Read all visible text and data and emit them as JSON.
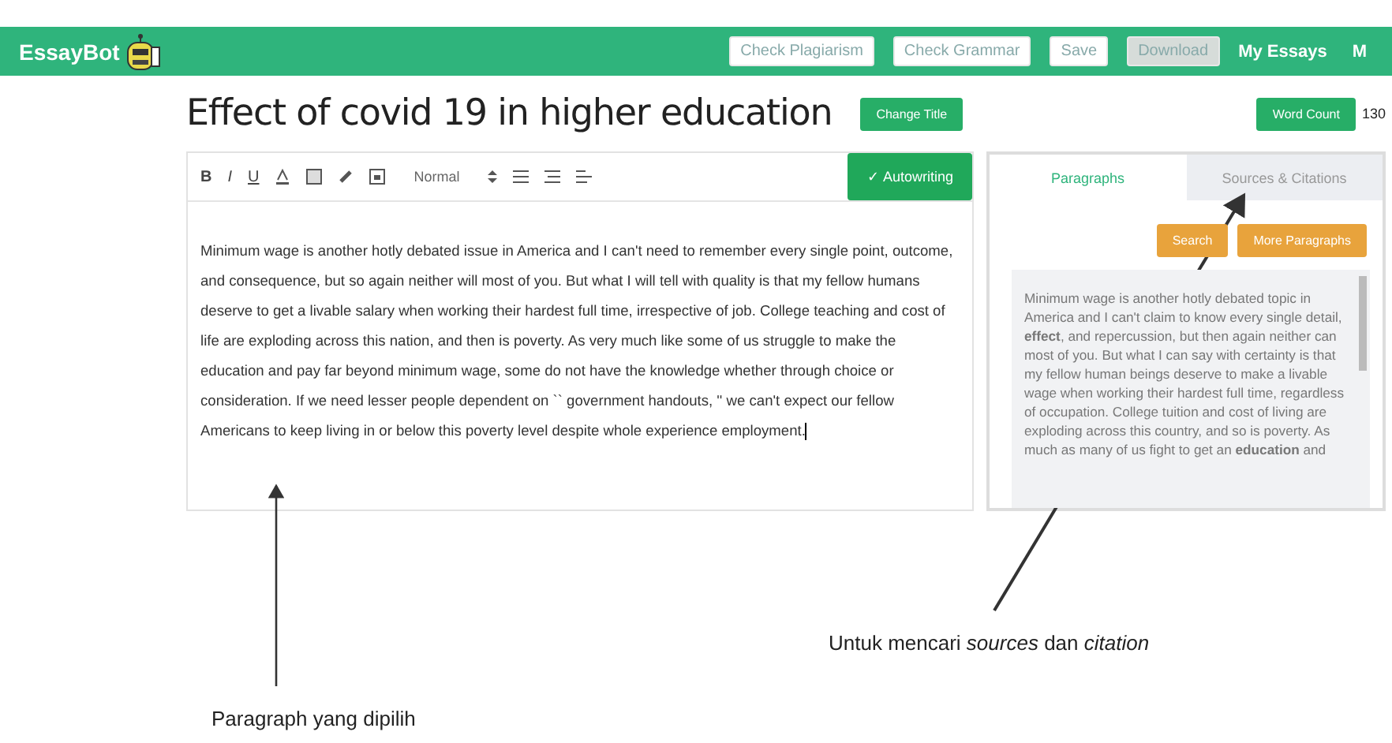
{
  "navbar": {
    "logo": "EssayBot",
    "buttons": [
      {
        "label": "Check Plagiarism",
        "kind": "outline"
      },
      {
        "label": "Check Grammar",
        "kind": "outline"
      },
      {
        "label": "Save",
        "kind": "outline"
      },
      {
        "label": "Download",
        "kind": "muted"
      }
    ],
    "links": [
      "My Essays",
      "M"
    ]
  },
  "essay": {
    "title": "Effect of covid 19 in higher education",
    "change_title": "Change Title",
    "word_count_button": "Word Count",
    "word_count": "130"
  },
  "editor": {
    "styles": [
      {
        "label": "B",
        "kind": "bold"
      },
      {
        "label": "I",
        "kind": "italic"
      },
      {
        "label": "U",
        "kind": "underline"
      }
    ],
    "format": "Normal",
    "autowriting": "✓ Autowriting",
    "text": "Minimum wage is another hotly debated issue in America and I can't need to remember every single point, outcome, and consequence, but so again neither will most of you. But what I will tell with quality is that my fellow humans deserve to get a livable salary when working their hardest full time, irrespective of job. College teaching and cost of life are exploding across this nation, and then is poverty. As very much like some of us struggle to make the education and pay far beyond minimum wage, some do not have the knowledge whether through choice or consideration. If we need lesser people dependent on `` government handouts, '' we can't expect our fellow Americans to keep living in or below this poverty level despite whole experience employment."
  },
  "side_panel": {
    "tabs": [
      {
        "label": "Paragraphs",
        "selected": true
      },
      {
        "label": "Sources & Citations",
        "selected": false
      }
    ],
    "buttons": [
      "Search",
      "More Paragraphs"
    ],
    "paragraph": "Minimum wage is another hotly debated topic in America and I can't claim to know every single detail, **effect**, and repercussion, but then again neither can most of you. But what I can say with certainty is that my fellow human beings deserve to make a livable wage when working their hardest full time, regardless of occupation. College tuition and cost of living are exploding across this country, and so is poverty. As much as many of us fight to get an **education** and"
  },
  "annotations": [
    {
      "text": "Paragraph yang  dipilih"
    },
    {
      "text": "Untuk mencari *sources* dan *citation*"
    }
  ]
}
